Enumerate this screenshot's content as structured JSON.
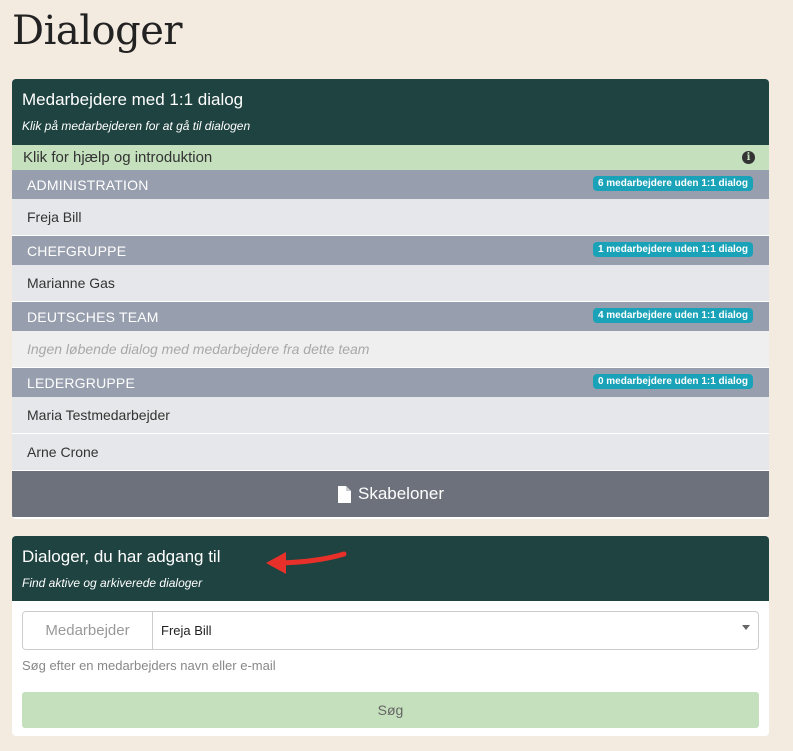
{
  "page": {
    "title": "Dialoger"
  },
  "dialogs_card": {
    "title": "Medarbejdere med 1:1 dialog",
    "subtitle": "Klik på medarbejderen for at gå til dialogen",
    "help_text": "Klik for hjælp og introduktion",
    "help_icon": "info-icon",
    "groups": [
      {
        "name": "ADMINISTRATION",
        "badge": "6 medarbejdere uden 1:1 dialog",
        "members": [
          "Freja Bill"
        ],
        "empty_text": ""
      },
      {
        "name": "CHEFGRUPPE",
        "badge": "1 medarbejdere uden 1:1 dialog",
        "members": [
          "Marianne Gas"
        ],
        "empty_text": ""
      },
      {
        "name": "DEUTSCHES TEAM",
        "badge": "4 medarbejdere uden 1:1 dialog",
        "members": [],
        "empty_text": "Ingen løbende dialog med medarbejdere fra dette team"
      },
      {
        "name": "LEDERGRUPPE",
        "badge": "0 medarbejdere uden 1:1 dialog",
        "members": [
          "Maria Testmedarbejder",
          "Arne Crone"
        ],
        "empty_text": ""
      }
    ],
    "templates_button": "Skabeloner",
    "templates_icon": "file-icon"
  },
  "access_card": {
    "title": "Dialoger, du har adgang til",
    "subtitle": "Find aktive og arkiverede dialoger",
    "employee_label": "Medarbejder",
    "employee_value": "Freja Bill",
    "help_text": "Søg efter en medarbejders navn eller e-mail",
    "search_button": "Søg"
  },
  "colors": {
    "background": "#f4ebe0",
    "header": "#1e4340",
    "help_row": "#c5e0bd",
    "group_header": "#979ead",
    "badge": "#1aa2b8",
    "templates_button": "#6c717b",
    "arrow": "#e8302b"
  }
}
